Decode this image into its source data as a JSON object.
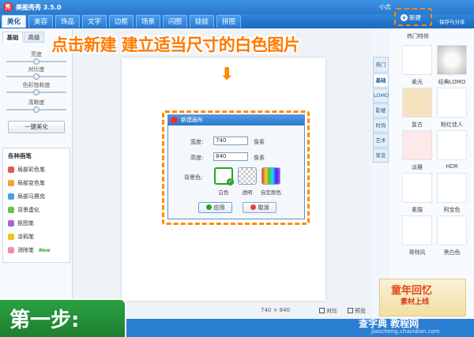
{
  "app": {
    "title": "美图秀秀 3.5.0",
    "logo_char": "秀"
  },
  "menu": {
    "tabs": [
      "美化",
      "美容",
      "饰品",
      "文字",
      "边框",
      "场景",
      "闪图",
      "娃娃",
      "拼图"
    ],
    "user": "小志",
    "new_label": "新建",
    "save_share_label": "保存与分享"
  },
  "left_panel": {
    "tabs": [
      "基础",
      "高级"
    ],
    "sliders": [
      {
        "label": "亮度",
        "value": 0.5
      },
      {
        "label": "对比度",
        "value": 0.5
      },
      {
        "label": "色彩饱和度",
        "value": 0.5
      },
      {
        "label": "清晰度",
        "value": 0.5
      }
    ],
    "auto_beautify_label": "一键美化",
    "brush_title": "各种画笔",
    "brushes": [
      {
        "label": "局部彩色笔",
        "color": "#e85a4f"
      },
      {
        "label": "局部变色笔",
        "color": "#f2a23c"
      },
      {
        "label": "局部马赛克",
        "color": "#4aa3df"
      },
      {
        "label": "背景虚化",
        "color": "#6cc04a"
      },
      {
        "label": "抠图笔",
        "color": "#9b6bd3"
      },
      {
        "label": "涂鸦笔",
        "color": "#f0c419"
      },
      {
        "label": "消除笔",
        "color": "#f08ab0",
        "badge": "New"
      }
    ]
  },
  "headline": "点击新建 建立适当尺寸的白色图片",
  "dialog": {
    "title": "新建画布",
    "width_label": "宽度:",
    "width_value": "740",
    "height_label": "高度:",
    "height_value": "840",
    "unit": "像素",
    "bg_label": "背景色:",
    "bg_options": [
      "白色",
      "透明",
      "自定颜色"
    ],
    "apply_label": "应用",
    "cancel_label": "取消"
  },
  "right_tabs": [
    "热门",
    "基础",
    "LOMO",
    "影楼",
    "时尚",
    "艺术",
    "渐变"
  ],
  "effects": {
    "header": "热门特效",
    "items": [
      {
        "label": "柔光",
        "color": "#ffffff"
      },
      {
        "label": "经典LOMO",
        "color": "#d9d6d0"
      },
      {
        "label": "复古",
        "color": "#f7e2c0"
      },
      {
        "label": "粉红佳人",
        "color": "#ffffff"
      },
      {
        "label": "淡雅",
        "color": "#fde8ea"
      },
      {
        "label": "HDR",
        "color": "#ffffff"
      },
      {
        "label": "素描",
        "color": "#ffffff"
      },
      {
        "label": "阿宝色",
        "color": "#ffffff"
      },
      {
        "label": "哥特风",
        "color": "#ffffff"
      },
      {
        "label": "黑白色",
        "color": "#ffffff"
      }
    ]
  },
  "ad": {
    "line1": "童年回忆",
    "line2": "素材上线"
  },
  "status": {
    "size": "740 × 840",
    "compare_label": "对比",
    "preview_label": "预览"
  },
  "step_label": "第一步:",
  "watermark": {
    "text": "查字典 教程网",
    "url": "jiaocheng.chazidian.com"
  },
  "colors": {
    "accent_orange": "#ff8a00",
    "brand_blue": "#2a78cd",
    "step_green": "#2aa142"
  }
}
